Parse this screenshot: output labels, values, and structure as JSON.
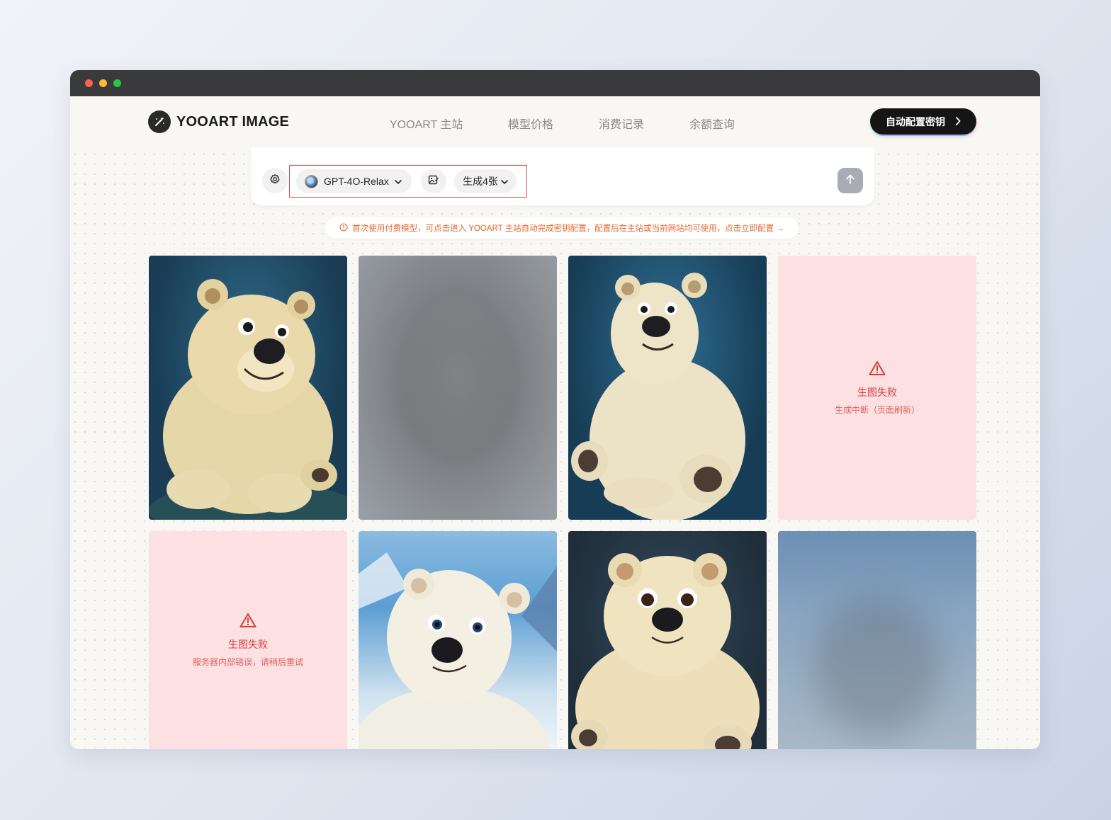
{
  "app": {
    "name": "YOOART IMAGE"
  },
  "nav": [
    {
      "label": "YOOART 主站"
    },
    {
      "label": "模型价格"
    },
    {
      "label": "消费记录"
    },
    {
      "label": "余额查询"
    }
  ],
  "cta": {
    "label": "自动配置密钥"
  },
  "composer": {
    "model_label": "GPT-4O-Relax",
    "count_label": "生成4张"
  },
  "notice": {
    "text": "首次使用付费模型，可点击进入 YOOART 主站自动完成密钥配置，配置后在主站或当前网站均可使用，点击立即配置 →"
  },
  "gallery": [
    {
      "status": "image",
      "subject": "polar-bear"
    },
    {
      "status": "blurred"
    },
    {
      "status": "image",
      "subject": "polar-bear"
    },
    {
      "status": "failed",
      "title": "生图失败",
      "reason": "生成中断（页面刷新）"
    },
    {
      "status": "failed",
      "title": "生图失败",
      "reason": "服务器内部错误，请稍后重试"
    },
    {
      "status": "image",
      "subject": "polar-bear"
    },
    {
      "status": "image",
      "subject": "polar-bear"
    },
    {
      "status": "blurred"
    }
  ],
  "colors": {
    "accent_error": "#d43c3c",
    "notice_text": "#e0672e",
    "cta_bg": "#151515",
    "highlight_border": "#e04a4a"
  }
}
